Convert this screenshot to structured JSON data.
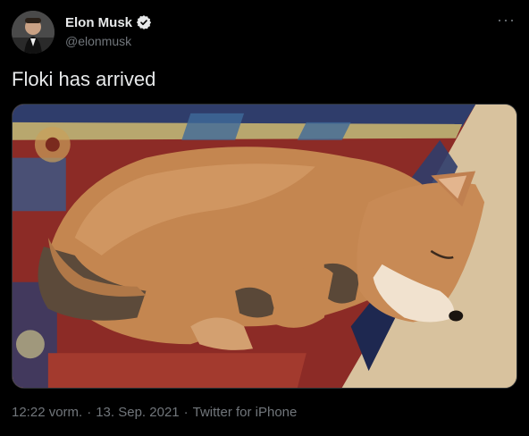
{
  "author": {
    "name": "Elon Musk",
    "handle": "@elonmusk",
    "verified": true
  },
  "tweet": {
    "text": "Floki has arrived",
    "more_icon": "more-dots-icon"
  },
  "meta": {
    "time": "12:22 vorm.",
    "sep1": "·",
    "date": "13. Sep. 2021",
    "sep2": "·",
    "source": "Twitter for iPhone"
  },
  "colors": {
    "background": "#000000",
    "primary_text": "#e7e9ea",
    "secondary_text": "#71767b",
    "verified_badge": "#ffffff"
  }
}
